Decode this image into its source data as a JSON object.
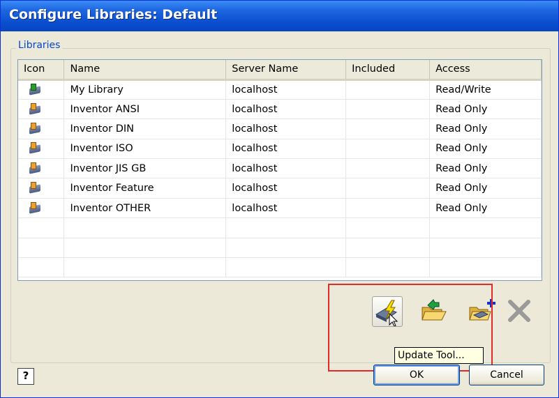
{
  "window": {
    "title": "Configure Libraries: Default"
  },
  "group": {
    "label": "Libraries"
  },
  "table": {
    "columns": [
      "Icon",
      "Name",
      "Server Name",
      "Included",
      "Access"
    ],
    "rows": [
      {
        "icon": "library-readwrite-icon",
        "name": "My Library",
        "server": "localhost",
        "included": "",
        "access": "Read/Write"
      },
      {
        "icon": "library-readonly-icon",
        "name": "Inventor ANSI",
        "server": "localhost",
        "included": "",
        "access": "Read Only"
      },
      {
        "icon": "library-readonly-icon",
        "name": "Inventor DIN",
        "server": "localhost",
        "included": "",
        "access": "Read Only"
      },
      {
        "icon": "library-readonly-icon",
        "name": "Inventor ISO",
        "server": "localhost",
        "included": "",
        "access": "Read Only"
      },
      {
        "icon": "library-readonly-icon",
        "name": "Inventor JIS GB",
        "server": "localhost",
        "included": "",
        "access": "Read Only"
      },
      {
        "icon": "library-readonly-icon",
        "name": "Inventor Feature",
        "server": "localhost",
        "included": "",
        "access": "Read Only"
      },
      {
        "icon": "library-readonly-icon",
        "name": "Inventor OTHER",
        "server": "localhost",
        "included": "",
        "access": "Read Only"
      }
    ]
  },
  "toolbar": {
    "update_icon": "update-tool-icon",
    "open_icon": "open-library-folder-icon",
    "add_icon": "add-library-icon",
    "delete_icon": "delete-x-icon",
    "tooltip": "Update Tool..."
  },
  "buttons": {
    "help": "?",
    "ok": "OK",
    "cancel": "Cancel"
  },
  "colors": {
    "titlebar": "#0a4fd0",
    "highlight": "#e32a2a",
    "group_label": "#0046d5"
  }
}
